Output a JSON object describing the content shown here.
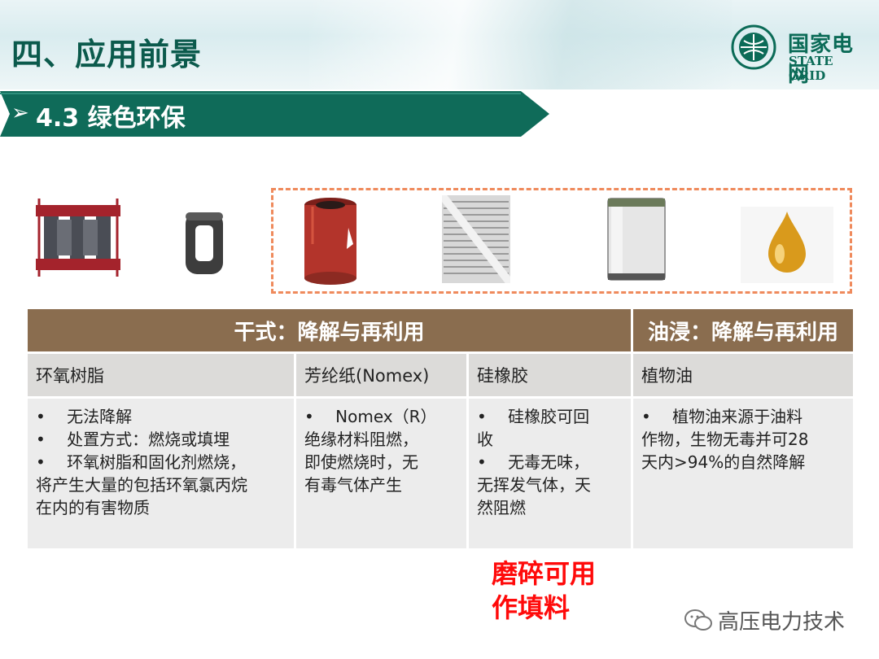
{
  "header": {
    "title": "四、应用前景"
  },
  "logo": {
    "cn": "国家电网",
    "en": "STATE GRID"
  },
  "section": {
    "bullet": "➢",
    "title": "4.3 绿色环保"
  },
  "images": [
    {
      "icon": "transformer-core-icon",
      "color": "#a4232c"
    },
    {
      "icon": "coil-core-icon",
      "color": "#3d3d3d"
    },
    {
      "icon": "coil-winding-icon",
      "color": "#b3342b"
    },
    {
      "icon": "aramid-paper-icon",
      "color": "#c9c9c9"
    },
    {
      "icon": "silicone-cylinder-icon",
      "color": "#e6e6e6"
    },
    {
      "icon": "oil-drop-icon",
      "color": "#d99a1c"
    }
  ],
  "table": {
    "headers": [
      "干式：降解与再利用",
      "油浸：降解与再利用"
    ],
    "columns": [
      {
        "name": "环氧树脂",
        "lines": [
          "•　 无法降解",
          "•　 处置方式：燃烧或填埋",
          "•　 环氧树脂和固化剂燃烧，",
          "将产生大量的包括环氧氯丙烷",
          "在内的有害物质"
        ]
      },
      {
        "name": "芳纶纸(Nomex)",
        "lines": [
          "•　 Nomex（R）",
          "绝缘材料阻燃，",
          "即使燃烧时，无",
          "有毒气体产生"
        ]
      },
      {
        "name": "硅橡胶",
        "lines": [
          "•　 硅橡胶可回",
          "收",
          "•　 无毒无味，",
          "无挥发气体，天",
          "然阻燃"
        ]
      },
      {
        "name": "植物油",
        "lines": [
          "•　 植物油来源于油料",
          "作物，生物无毒并可28",
          "天内>94%的自然降解"
        ]
      }
    ]
  },
  "note": {
    "line1": "磨碎可用",
    "line2": "作填料"
  },
  "watermark": {
    "text": "高压电力技术"
  }
}
